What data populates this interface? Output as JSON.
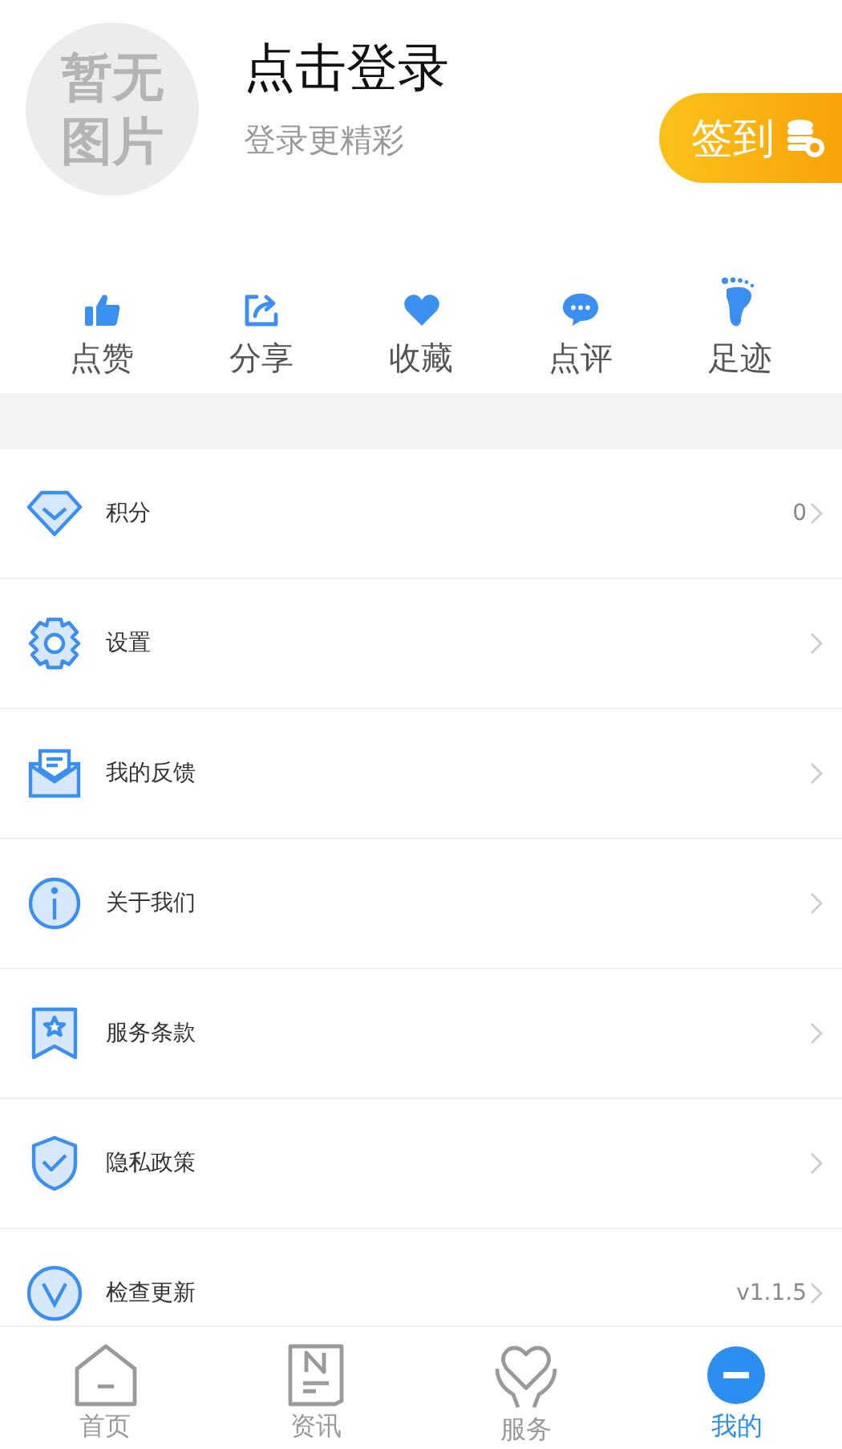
{
  "header": {
    "avatar_text": "暂无图片",
    "title": "点击登录",
    "subtitle": "登录更精彩",
    "sign_in_button": "签到"
  },
  "actions": [
    {
      "label": "点赞",
      "kind": "like"
    },
    {
      "label": "分享",
      "kind": "share"
    },
    {
      "label": "收藏",
      "kind": "favorite"
    },
    {
      "label": "点评",
      "kind": "comment"
    },
    {
      "label": "足迹",
      "kind": "footprint"
    }
  ],
  "menu": [
    {
      "label": "积分",
      "value": "0",
      "kind": "points"
    },
    {
      "label": "设置",
      "kind": "settings"
    },
    {
      "label": "我的反馈",
      "kind": "feedback"
    },
    {
      "label": "关于我们",
      "kind": "about"
    },
    {
      "label": "服务条款",
      "kind": "terms"
    },
    {
      "label": "隐私政策",
      "kind": "privacy"
    },
    {
      "label": "检查更新",
      "value": "v1.1.5",
      "kind": "update"
    }
  ],
  "tabs": [
    {
      "label": "首页",
      "kind": "home",
      "selected": false
    },
    {
      "label": "资讯",
      "kind": "news",
      "selected": false
    },
    {
      "label": "服务",
      "kind": "service",
      "selected": false
    },
    {
      "label": "我的",
      "kind": "me",
      "selected": true
    }
  ]
}
